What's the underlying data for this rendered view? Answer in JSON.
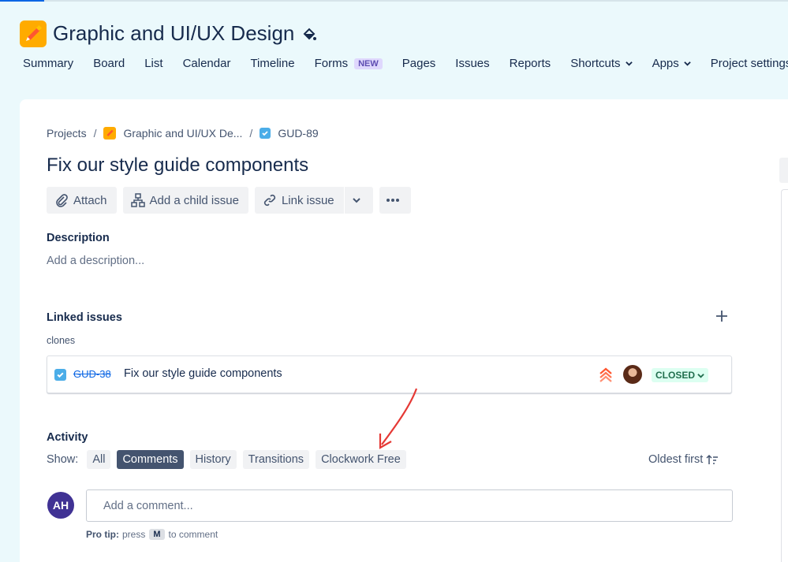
{
  "project": {
    "title": "Graphic and UI/UX Design",
    "icon": "pencil-icon",
    "color": "#ffab00"
  },
  "nav": [
    {
      "label": "Summary"
    },
    {
      "label": "Board"
    },
    {
      "label": "List"
    },
    {
      "label": "Calendar"
    },
    {
      "label": "Timeline"
    },
    {
      "label": "Forms",
      "badge": "NEW"
    },
    {
      "label": "Pages"
    },
    {
      "label": "Issues"
    },
    {
      "label": "Reports"
    },
    {
      "label": "Shortcuts",
      "dropdown": true
    },
    {
      "label": "Apps",
      "dropdown": true
    },
    {
      "label": "Project settings"
    }
  ],
  "breadcrumb": {
    "root": "Projects",
    "project": "Graphic and UI/UX De...",
    "issue_key": "GUD-89"
  },
  "issue": {
    "title": "Fix our style guide components"
  },
  "toolbar": {
    "attach": "Attach",
    "add_child": "Add a child issue",
    "link_issue": "Link issue"
  },
  "description": {
    "label": "Description",
    "placeholder": "Add a description..."
  },
  "linked_issues": {
    "label": "Linked issues",
    "relation": "clones",
    "items": [
      {
        "key": "GUD-38",
        "summary": "Fix our style guide components",
        "priority": "highest-priority-icon",
        "status": "CLOSED",
        "status_color": "#dcfff1"
      }
    ]
  },
  "activity": {
    "label": "Activity",
    "show_label": "Show:",
    "filters": [
      "All",
      "Comments",
      "History",
      "Transitions",
      "Clockwork Free"
    ],
    "active_filter": "Comments",
    "sort": "Oldest first"
  },
  "comment": {
    "avatar_initials": "AH",
    "placeholder": "Add a comment...",
    "tip_prefix": "Pro tip:",
    "tip_press": "press",
    "tip_key": "M",
    "tip_suffix": "to comment"
  }
}
